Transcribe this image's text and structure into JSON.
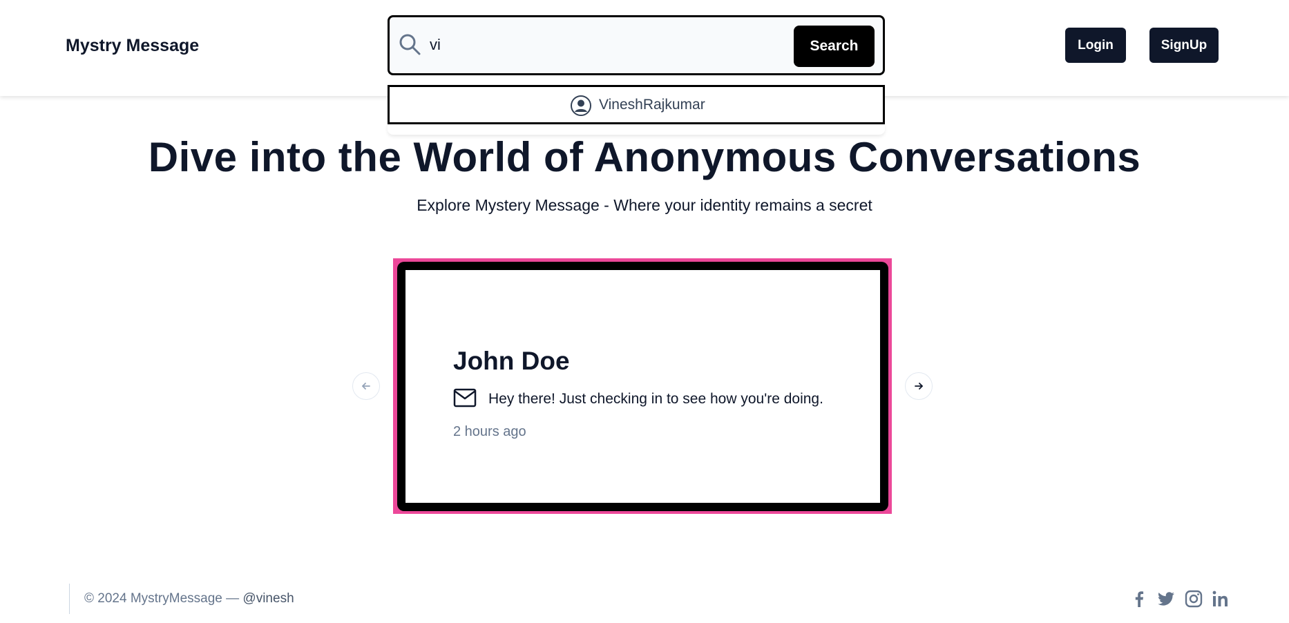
{
  "header": {
    "brand": "Mystry Message",
    "search": {
      "value": "vi",
      "button_label": "Search"
    },
    "suggestions": [
      {
        "label": "VineshRajkumar",
        "icon": "user-circle-icon"
      }
    ],
    "login_label": "Login",
    "signup_label": "SignUp"
  },
  "hero": {
    "title": "Dive into the World of Anonymous Conversations",
    "subtitle": "Explore Mystery Message - Where your identity remains a secret"
  },
  "carousel": {
    "card": {
      "title": "John Doe",
      "message": "Hey there! Just checking in to see how you're doing.",
      "time": "2 hours ago",
      "icon": "mail-icon"
    },
    "prev_icon": "arrow-left-icon",
    "next_icon": "arrow-right-icon"
  },
  "footer": {
    "copyright": "© 2024 MystryMessage —",
    "handle": "@vinesh",
    "social": [
      "facebook-icon",
      "twitter-icon",
      "instagram-icon",
      "linkedin-icon"
    ]
  },
  "colors": {
    "primary_dark": "#0f172a",
    "black": "#000000",
    "frame_pink": "#ec4899",
    "muted_text": "#64748b"
  }
}
